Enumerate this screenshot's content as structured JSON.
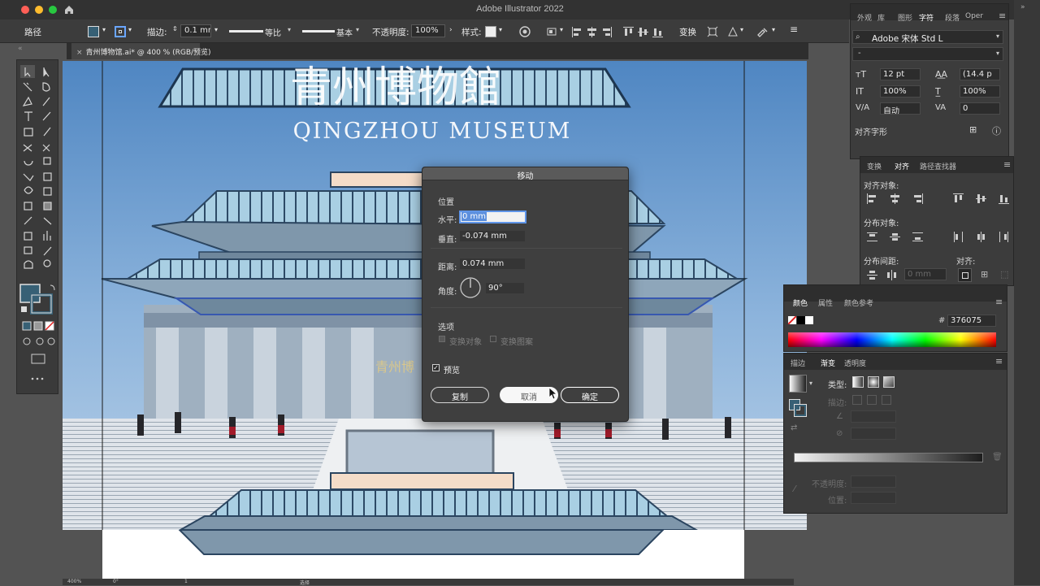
{
  "app": {
    "title": "Adobe Illustrator 2022"
  },
  "control_bar": {
    "selection_label": "路径",
    "stroke_label": "描边:",
    "stroke_value": "0.1 mm",
    "stroke_profile": "等比",
    "brush": "基本",
    "opacity_label": "不透明度:",
    "opacity_value": "100%",
    "style_label": "样式:",
    "transform_label": "变换"
  },
  "document_tab": {
    "label": "青州博物馆.ai* @ 400 % (RGB/预览)"
  },
  "artwork": {
    "title_cn": "青州博物館",
    "title_en": "QINGZHOU MUSEUM",
    "building_sign": "青州博"
  },
  "move_dialog": {
    "title": "移动",
    "position_heading": "位置",
    "horizontal_label": "水平:",
    "horizontal_value": "0 mm",
    "vertical_label": "垂直:",
    "vertical_value": "-0.074 mm",
    "distance_label": "距离:",
    "distance_value": "0.074 mm",
    "angle_label": "角度:",
    "angle_value": "90°",
    "options_heading": "选项",
    "transform_objects": "变换对象",
    "transform_patterns": "变换图案",
    "preview_label": "预览",
    "copy_button": "复制",
    "cancel_button": "取消",
    "ok_button": "确定"
  },
  "character_panel": {
    "tabs": [
      "外观",
      "库",
      "图形",
      "字符",
      "段落",
      "Oper"
    ],
    "active_tab": "字符",
    "font_family": "Adobe 宋体 Std L",
    "font_style": "-",
    "font_size": "12 pt",
    "leading": "(14.4 p",
    "vertical_scale": "100%",
    "horizontal_scale": "100%",
    "kerning": "自动",
    "tracking": "0",
    "align_glyph_label": "对齐字形"
  },
  "align_panel": {
    "tabs": [
      "变换",
      "对齐",
      "路径查找器"
    ],
    "active_tab": "对齐",
    "align_objects_label": "对齐对象:",
    "distribute_objects_label": "分布对象:",
    "distribute_spacing_label": "分布间距:",
    "align_to_label": "对齐:",
    "spacing_value": "0 mm"
  },
  "color_panel": {
    "tabs": [
      "颜色",
      "属性",
      "颜色参考"
    ],
    "active_tab": "颜色",
    "hex_prefix": "#",
    "hex_value": "376075"
  },
  "gradient_panel": {
    "tabs": [
      "描边",
      "渐变",
      "透明度"
    ],
    "active_tab": "渐变",
    "type_label": "类型:",
    "stroke_label": "描边:",
    "opacity_label": "不透明度:",
    "location_label": "位置:"
  },
  "status_bar": {
    "zoom": "400%",
    "angle": "0°",
    "artboard": "1",
    "mode": "选择"
  },
  "colors": {
    "fill": "#376075",
    "accent": "#2f6fd6"
  }
}
